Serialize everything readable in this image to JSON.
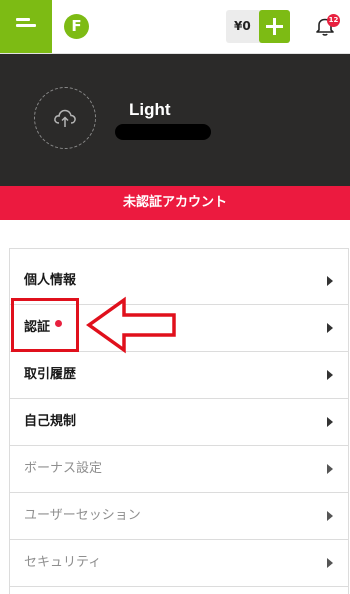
{
  "header": {
    "logo_letter": "F",
    "balance": "¥0",
    "notification_count": "12",
    "accent_color": "#7dbb14"
  },
  "profile": {
    "username": "Light",
    "avatar_icon": "cloud-upload-icon"
  },
  "banner": {
    "text": "未認証アカウント",
    "color": "#ec1a3f"
  },
  "menu": {
    "items": [
      {
        "label": "個人情報"
      },
      {
        "label": "認証"
      },
      {
        "label": "取引履歴"
      },
      {
        "label": "自己規制"
      },
      {
        "label": "ボーナス設定"
      },
      {
        "label": "ユーザーセッション"
      },
      {
        "label": "セキュリティ"
      }
    ]
  }
}
